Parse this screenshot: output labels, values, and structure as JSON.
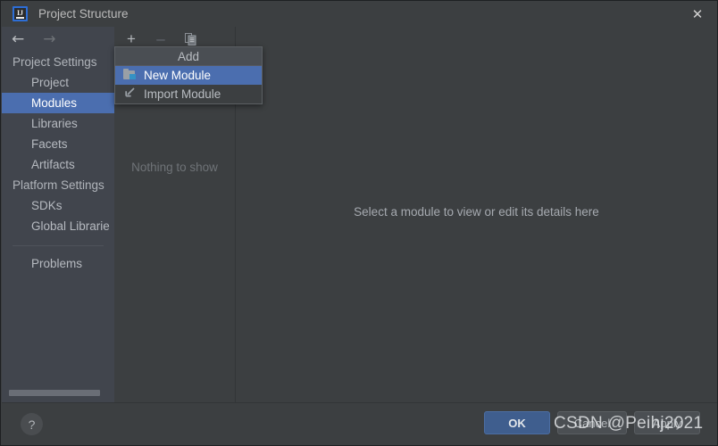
{
  "window": {
    "title": "Project Structure",
    "logo_text": "IJ",
    "close_icon": "✕"
  },
  "nav": {
    "back_icon": "←",
    "forward_icon": "→"
  },
  "sidebar": {
    "items": [
      {
        "label": "Project Settings",
        "type": "group",
        "selected": false
      },
      {
        "label": "Project",
        "type": "child",
        "selected": false
      },
      {
        "label": "Modules",
        "type": "child",
        "selected": true
      },
      {
        "label": "Libraries",
        "type": "child",
        "selected": false
      },
      {
        "label": "Facets",
        "type": "child",
        "selected": false
      },
      {
        "label": "Artifacts",
        "type": "child",
        "selected": false
      },
      {
        "label": "Platform Settings",
        "type": "group",
        "selected": false
      },
      {
        "label": "SDKs",
        "type": "child",
        "selected": false
      },
      {
        "label": "Global Librarie",
        "type": "child",
        "selected": false
      },
      {
        "label": "",
        "type": "separator",
        "selected": false
      },
      {
        "label": "Problems",
        "type": "child",
        "selected": false
      }
    ]
  },
  "modules_panel": {
    "toolbar": {
      "add_icon": "＋",
      "remove_icon": "−",
      "copy_icon": "copy-icon"
    },
    "empty_text": "Nothing to show"
  },
  "add_menu": {
    "header": "Add",
    "items": [
      {
        "label": "New Module",
        "icon": "folder-icon",
        "highlighted": true
      },
      {
        "label": "Import Module",
        "icon": "import-arrow-icon",
        "highlighted": false
      }
    ]
  },
  "detail_panel": {
    "message": "Select a module to view or edit its details here"
  },
  "bottom_bar": {
    "help_icon": "?",
    "ok_label": "OK",
    "cancel_label": "Cancel",
    "apply_label": "Apply"
  },
  "watermark": {
    "text": "CSDN @Peihj2021"
  },
  "colors": {
    "window_bg": "#3c3f41",
    "sidebar_bg": "#41454d",
    "selection": "#4b6eaf",
    "accent_button": "#3f5e8e",
    "text": "#b6bac0",
    "muted_text": "#6f7377",
    "folder_accent": "#3592c4"
  }
}
